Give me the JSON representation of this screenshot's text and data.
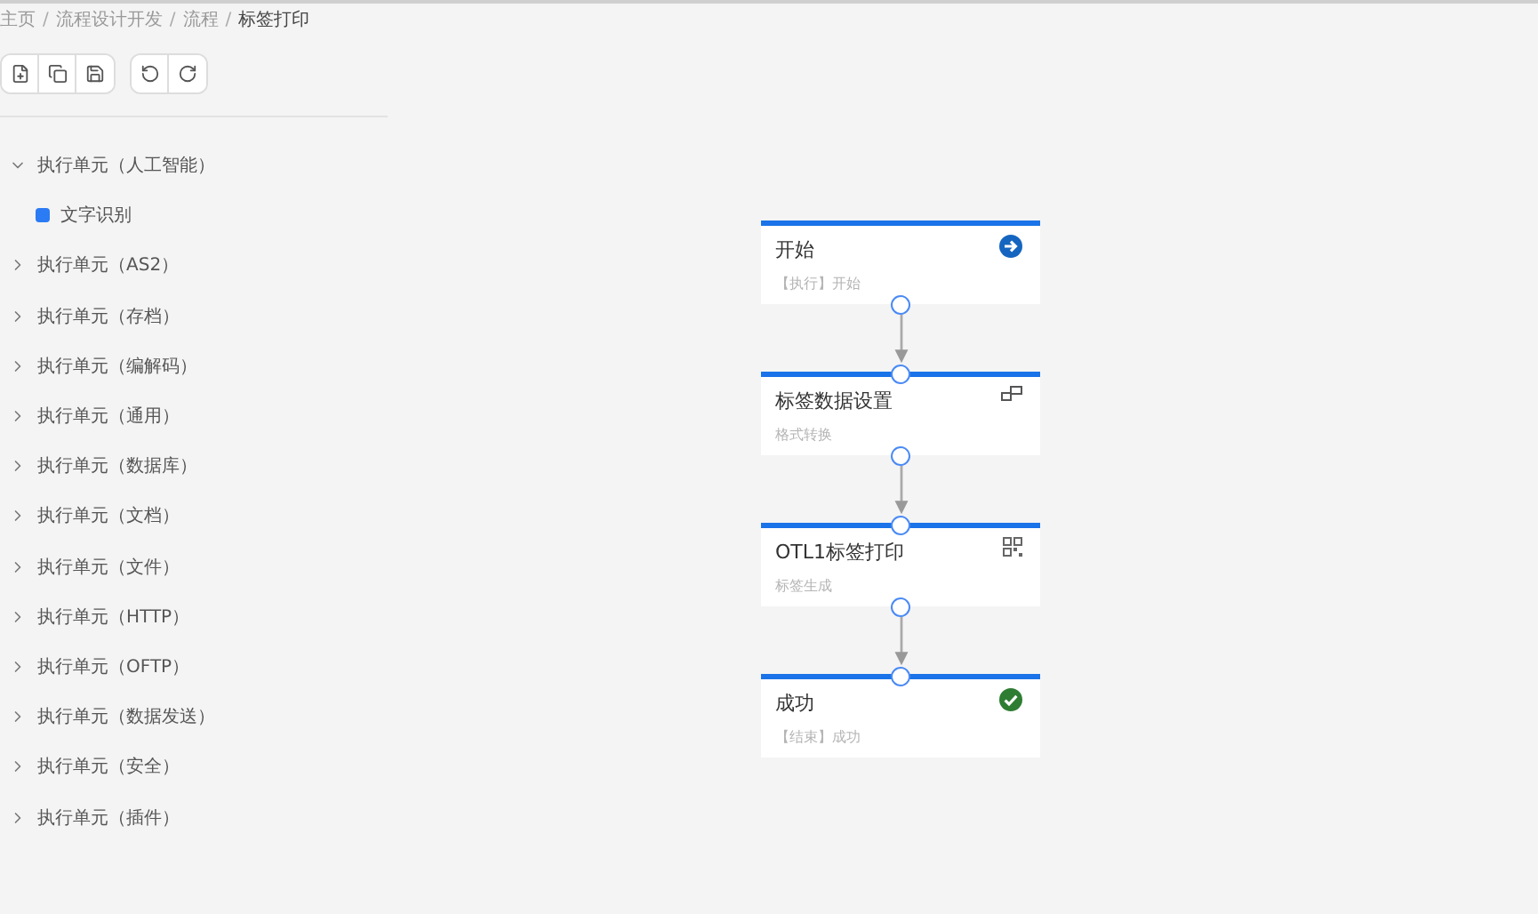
{
  "breadcrumb": [
    {
      "label": "主页",
      "current": false,
      "separator": "/"
    },
    {
      "label": "流程设计开发",
      "current": false,
      "separator": "/"
    },
    {
      "label": "流程",
      "current": false,
      "separator": "/"
    },
    {
      "label": "标签打印",
      "current": true
    }
  ],
  "sidebar": {
    "items": [
      {
        "label": "执行单元（人工智能）",
        "expanded": true,
        "children": [
          {
            "label": "文字识别"
          }
        ]
      },
      {
        "label": "执行单元（AS2）",
        "expanded": false
      },
      {
        "label": "执行单元（存档）",
        "expanded": false
      },
      {
        "label": "执行单元（编解码）",
        "expanded": false
      },
      {
        "label": "执行单元（通用）",
        "expanded": false
      },
      {
        "label": "执行单元（数据库）",
        "expanded": false
      },
      {
        "label": "执行单元（文档）",
        "expanded": false
      },
      {
        "label": "执行单元（文件）",
        "expanded": false
      },
      {
        "label": "执行单元（HTTP）",
        "expanded": false
      },
      {
        "label": "执行单元（OFTP）",
        "expanded": false
      },
      {
        "label": "执行单元（数据发送）",
        "expanded": false
      },
      {
        "label": "执行单元（安全）",
        "expanded": false
      },
      {
        "label": "执行单元（插件）",
        "expanded": false
      }
    ]
  },
  "flow": {
    "nodes": [
      {
        "kind": "start",
        "title": "开始",
        "subtitle": "【执行】开始"
      },
      {
        "kind": "transform",
        "title": "标签数据设置",
        "subtitle": "格式转换"
      },
      {
        "kind": "print",
        "title": "OTL1标签打印",
        "subtitle": "标签生成"
      },
      {
        "kind": "success",
        "title": "成功",
        "subtitle": "【结束】成功"
      }
    ]
  }
}
